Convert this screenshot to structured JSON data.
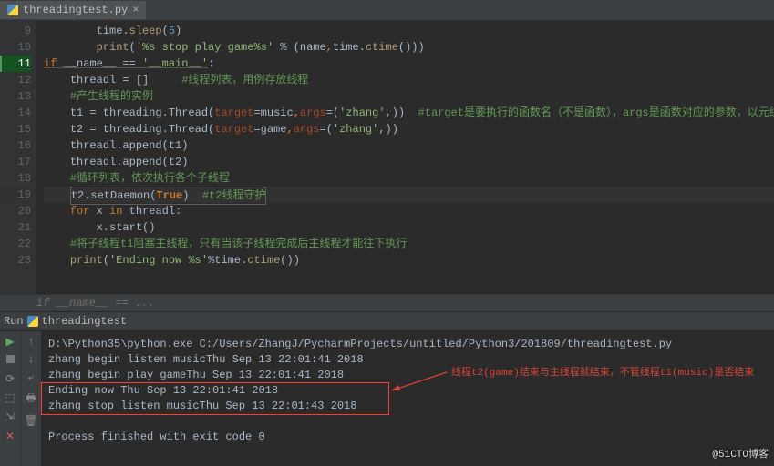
{
  "tab": {
    "filename": "threadingtest.py",
    "close": "×"
  },
  "gutter": [
    "9",
    "10",
    "11",
    "12",
    "13",
    "14",
    "15",
    "16",
    "17",
    "18",
    "19",
    "20",
    "21",
    "22",
    "23"
  ],
  "code": {
    "l9": {
      "indent": "        ",
      "a": "time.",
      "b": "sleep",
      "c": "(",
      "d": "5",
      "e": ")"
    },
    "l10": {
      "indent": "        ",
      "a": "print",
      "b": "(",
      "c": "'%s stop play game%s'",
      "d": " % (name",
      "e": ",",
      "f": "time.",
      "g": "ctime",
      "h": "()))"
    },
    "l11": {
      "a": "if",
      "b": " __name__ == ",
      "c": "'__main__'",
      "d": ":"
    },
    "l12": {
      "indent": "    ",
      "a": "threadl = []     ",
      "b": "#线程列表，用例存放线程"
    },
    "l13": {
      "indent": "    ",
      "a": "#产生线程的实例"
    },
    "l14": {
      "indent": "    ",
      "a": "t1 = threading.Thread(",
      "b": "target",
      "c": "=music",
      "d": ",",
      "e": "args",
      "f": "=(",
      "g": "'zhang'",
      "h": ",))  ",
      "i": "#target是要执行的函数名（不是函数），args是函数对应的参数，以元组的形式。"
    },
    "l15": {
      "indent": "    ",
      "a": "t2 = threading.Thread(",
      "b": "target",
      "c": "=game",
      "d": ",",
      "e": "args",
      "f": "=(",
      "g": "'zhang'",
      "h": ",))"
    },
    "l16": {
      "indent": "    ",
      "a": "threadl.append(t1)"
    },
    "l17": {
      "indent": "    ",
      "a": "threadl.append(t2)"
    },
    "l18": {
      "indent": "    ",
      "a": "#循环列表，依次执行各个子线程"
    },
    "l19": {
      "indent": "    ",
      "a": "t2.setDaemon(",
      "b": "True",
      "c": ")  ",
      "d": "#t2线程守护"
    },
    "l20": {
      "indent": "    ",
      "a": "for",
      "b": " x ",
      "c": "in",
      "d": " threadl:"
    },
    "l21": {
      "indent": "        ",
      "a": "x.start()"
    },
    "l22": {
      "indent": "    ",
      "a": "#将子线程t1阻塞主线程，只有当该子线程完成后主线程才能往下执行"
    },
    "l23": {
      "indent": "    ",
      "a": "print",
      "b": "(",
      "c": "'Ending now %s'",
      "d": "%",
      "e": "time.",
      "f": "ctime",
      "g": "())"
    }
  },
  "breadcrumb": "if __name__ == ...",
  "run": {
    "label": "Run",
    "config": "threadingtest"
  },
  "console": {
    "cmd": "D:\\Python35\\python.exe C:/Users/ZhangJ/PycharmProjects/untitled/Python3/201809/threadingtest.py",
    "l1": "zhang begin listen musicThu Sep 13 22:01:41 2018",
    "l2": "zhang begin play gameThu Sep 13 22:01:41 2018",
    "l3": "Ending now Thu Sep 13 22:01:41 2018",
    "l4": "zhang stop listen musicThu Sep 13 22:01:43 2018",
    "exit": "Process finished with exit code 0"
  },
  "annotation": "线程t2(game)结束与主线程就结束，不管线程t1(music)是否结束",
  "watermark": "@51CTO博客"
}
